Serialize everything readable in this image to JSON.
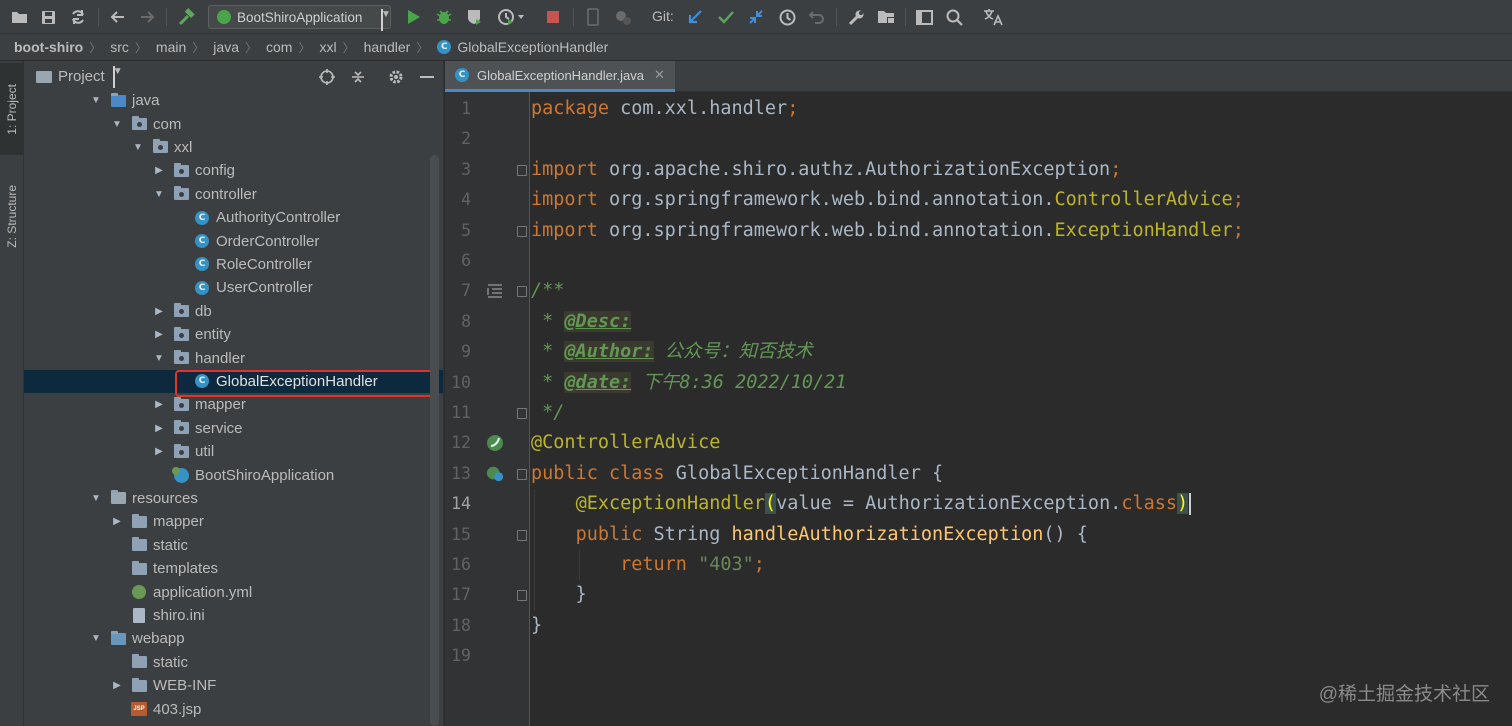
{
  "toolbar": {
    "run_config": "BootShiroApplication",
    "git_label": "Git:",
    "colors": {
      "run": "#4aa54a",
      "debug": "#4aa54a",
      "stop": "#c75450",
      "git_update": "#3d8fdb",
      "git_commit": "#5aa65a"
    }
  },
  "breadcrumb": {
    "items": [
      "boot-shiro",
      "src",
      "main",
      "java",
      "com",
      "xxl",
      "handler",
      "GlobalExceptionHandler"
    ]
  },
  "stripe": {
    "project_tab": "1: Project",
    "structure_tab": "Z: Structure"
  },
  "project_panel": {
    "title": "Project",
    "tree": [
      {
        "label": "java",
        "icon": "folder-source",
        "depth": 0,
        "arrow": "open"
      },
      {
        "label": "com",
        "icon": "folder-package",
        "depth": 1,
        "arrow": "open"
      },
      {
        "label": "xxl",
        "icon": "folder-package",
        "depth": 2,
        "arrow": "open"
      },
      {
        "label": "config",
        "icon": "folder-package",
        "depth": 3,
        "arrow": "closed"
      },
      {
        "label": "controller",
        "icon": "folder-package",
        "depth": 3,
        "arrow": "open"
      },
      {
        "label": "AuthorityController",
        "icon": "class",
        "depth": 4,
        "arrow": "none"
      },
      {
        "label": "OrderController",
        "icon": "class",
        "depth": 4,
        "arrow": "none"
      },
      {
        "label": "RoleController",
        "icon": "class",
        "depth": 4,
        "arrow": "none"
      },
      {
        "label": "UserController",
        "icon": "class",
        "depth": 4,
        "arrow": "none"
      },
      {
        "label": "db",
        "icon": "folder-package",
        "depth": 3,
        "arrow": "closed"
      },
      {
        "label": "entity",
        "icon": "folder-package",
        "depth": 3,
        "arrow": "closed"
      },
      {
        "label": "handler",
        "icon": "folder-package",
        "depth": 3,
        "arrow": "open"
      },
      {
        "label": "GlobalExceptionHandler",
        "icon": "class",
        "depth": 4,
        "arrow": "none",
        "selected": true
      },
      {
        "label": "mapper",
        "icon": "folder-package",
        "depth": 3,
        "arrow": "closed"
      },
      {
        "label": "service",
        "icon": "folder-package",
        "depth": 3,
        "arrow": "closed"
      },
      {
        "label": "util",
        "icon": "folder-package",
        "depth": 3,
        "arrow": "closed"
      },
      {
        "label": "BootShiroApplication",
        "icon": "spring-class",
        "depth": 3,
        "arrow": "none"
      },
      {
        "label": "resources",
        "icon": "folder-resources",
        "depth": 0,
        "arrow": "open"
      },
      {
        "label": "mapper",
        "icon": "folder",
        "depth": 1,
        "arrow": "closed"
      },
      {
        "label": "static",
        "icon": "folder",
        "depth": 1,
        "arrow": "none"
      },
      {
        "label": "templates",
        "icon": "folder",
        "depth": 1,
        "arrow": "none"
      },
      {
        "label": "application.yml",
        "icon": "yml-file",
        "depth": 1,
        "arrow": "none"
      },
      {
        "label": "shiro.ini",
        "icon": "ini-file",
        "depth": 1,
        "arrow": "none"
      },
      {
        "label": "webapp",
        "icon": "folder-web",
        "depth": 0,
        "arrow": "open"
      },
      {
        "label": "static",
        "icon": "folder",
        "depth": 1,
        "arrow": "none"
      },
      {
        "label": "WEB-INF",
        "icon": "folder",
        "depth": 1,
        "arrow": "closed"
      },
      {
        "label": "403.jsp",
        "icon": "jsp-file",
        "depth": 1,
        "arrow": "none"
      }
    ]
  },
  "editor": {
    "tab_label": "GlobalExceptionHandler.java",
    "current_line": 14,
    "lines": [
      {
        "n": 1,
        "tokens": [
          [
            "kw",
            "package"
          ],
          [
            "plain",
            " com.xxl.handler"
          ],
          [
            "kw",
            ";"
          ]
        ]
      },
      {
        "n": 2,
        "tokens": []
      },
      {
        "n": 3,
        "tokens": [
          [
            "kw",
            "import"
          ],
          [
            "plain",
            " org.apache.shiro.authz.AuthorizationException"
          ],
          [
            "kw",
            ";"
          ]
        ]
      },
      {
        "n": 4,
        "tokens": [
          [
            "kw",
            "import"
          ],
          [
            "plain",
            " org.springframework.web.bind.annotation."
          ],
          [
            "ann",
            "ControllerAdvice"
          ],
          [
            "kw",
            ";"
          ]
        ]
      },
      {
        "n": 5,
        "tokens": [
          [
            "kw",
            "import"
          ],
          [
            "plain",
            " org.springframework.web.bind.annotation."
          ],
          [
            "ann",
            "ExceptionHandler"
          ],
          [
            "kw",
            ";"
          ]
        ]
      },
      {
        "n": 6,
        "tokens": []
      },
      {
        "n": 7,
        "tokens": [
          [
            "doc",
            "/**"
          ]
        ]
      },
      {
        "n": 8,
        "tokens": [
          [
            "doc",
            " * "
          ],
          [
            "doctag",
            "@Desc:"
          ]
        ]
      },
      {
        "n": 9,
        "tokens": [
          [
            "doc",
            " * "
          ],
          [
            "doctag",
            "@Author:"
          ],
          [
            "doc",
            " 公众号：知否技术"
          ]
        ]
      },
      {
        "n": 10,
        "tokens": [
          [
            "doc",
            " * "
          ],
          [
            "doctag",
            "@date:"
          ],
          [
            "doc",
            " 下午8:36 2022/10/21"
          ]
        ]
      },
      {
        "n": 11,
        "tokens": [
          [
            "doc",
            " */"
          ]
        ]
      },
      {
        "n": 12,
        "tokens": [
          [
            "ann",
            "@ControllerAdvice"
          ]
        ]
      },
      {
        "n": 13,
        "tokens": [
          [
            "kw",
            "public class "
          ],
          [
            "plain",
            "GlobalExceptionHandler {"
          ]
        ]
      },
      {
        "n": 14,
        "tokens": [
          [
            "plain",
            "    "
          ],
          [
            "ann",
            "@ExceptionHandler"
          ],
          [
            "brace",
            "("
          ],
          [
            "plain",
            "value = AuthorizationException."
          ],
          [
            "kw",
            "class"
          ],
          [
            "brace",
            ")"
          ],
          [
            "caret",
            ""
          ]
        ]
      },
      {
        "n": 15,
        "tokens": [
          [
            "plain",
            "    "
          ],
          [
            "kw",
            "public "
          ],
          [
            "plain",
            "String "
          ],
          [
            "fn",
            "handleAuthorizationException"
          ],
          [
            "plain",
            "() {"
          ]
        ]
      },
      {
        "n": 16,
        "tokens": [
          [
            "plain",
            "        "
          ],
          [
            "kw",
            "return "
          ],
          [
            "str",
            "\"403\""
          ],
          [
            "kw",
            ";"
          ]
        ]
      },
      {
        "n": 17,
        "tokens": [
          [
            "plain",
            "    }"
          ]
        ]
      },
      {
        "n": 18,
        "tokens": [
          [
            "plain",
            "}"
          ]
        ]
      },
      {
        "n": 19,
        "tokens": []
      }
    ]
  },
  "watermark": "@稀土掘金技术社区"
}
